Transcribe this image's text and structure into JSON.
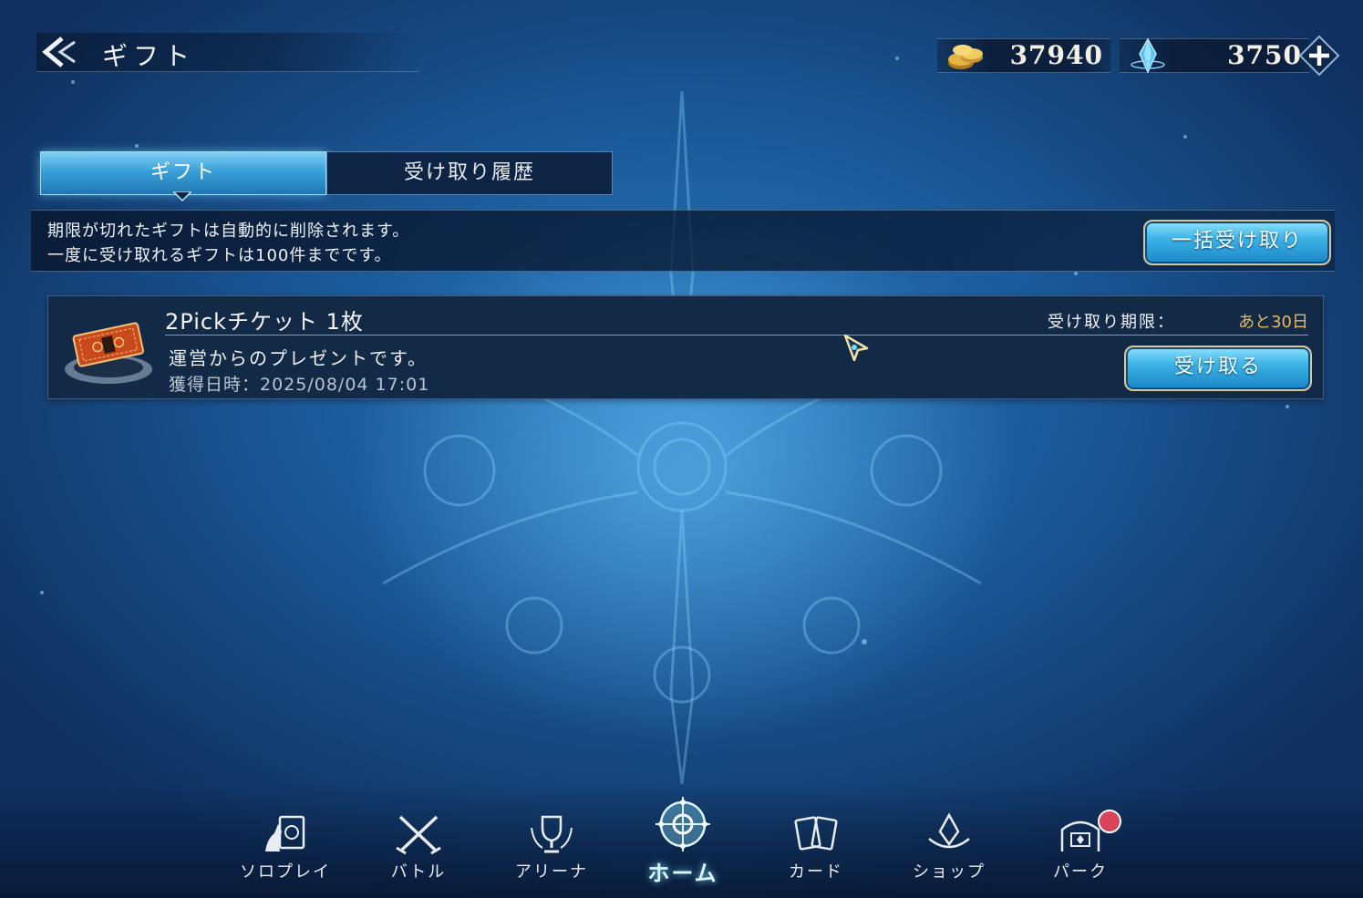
{
  "header": {
    "title": "ギフト",
    "gold_amount": "37940",
    "crystal_amount": "3750"
  },
  "tabs": [
    {
      "label": "ギフト",
      "active": true
    },
    {
      "label": "受け取り履歴",
      "active": false
    }
  ],
  "info": {
    "line1": "期限が切れたギフトは自動的に削除されます。",
    "line2": "一度に受け取れるギフトは100件までです。",
    "bulk_receive_label": "一括受け取り"
  },
  "gifts": [
    {
      "name": "2Pickチケット 1枚",
      "deadline_label": "受け取り期限：",
      "deadline_value": "あと30日",
      "description": "運営からのプレゼントです。",
      "acquired": "獲得日時：2025/08/04 17:01",
      "receive_label": "受け取る"
    }
  ],
  "nav": {
    "items": [
      {
        "label": "ソロプレイ",
        "icon": "solo-play-icon"
      },
      {
        "label": "バトル",
        "icon": "crossed-swords-icon"
      },
      {
        "label": "アリーナ",
        "icon": "trophy-icon"
      },
      {
        "label": "ホーム",
        "icon": "home-crest-icon",
        "active": true
      },
      {
        "label": "カード",
        "icon": "cards-icon"
      },
      {
        "label": "ショップ",
        "icon": "shop-crystal-icon"
      },
      {
        "label": "パーク",
        "icon": "park-gate-icon"
      }
    ]
  },
  "colors": {
    "accent_blue": "#3db3e6",
    "gold_text": "#e6b85c",
    "badge_red": "#d8455a"
  }
}
